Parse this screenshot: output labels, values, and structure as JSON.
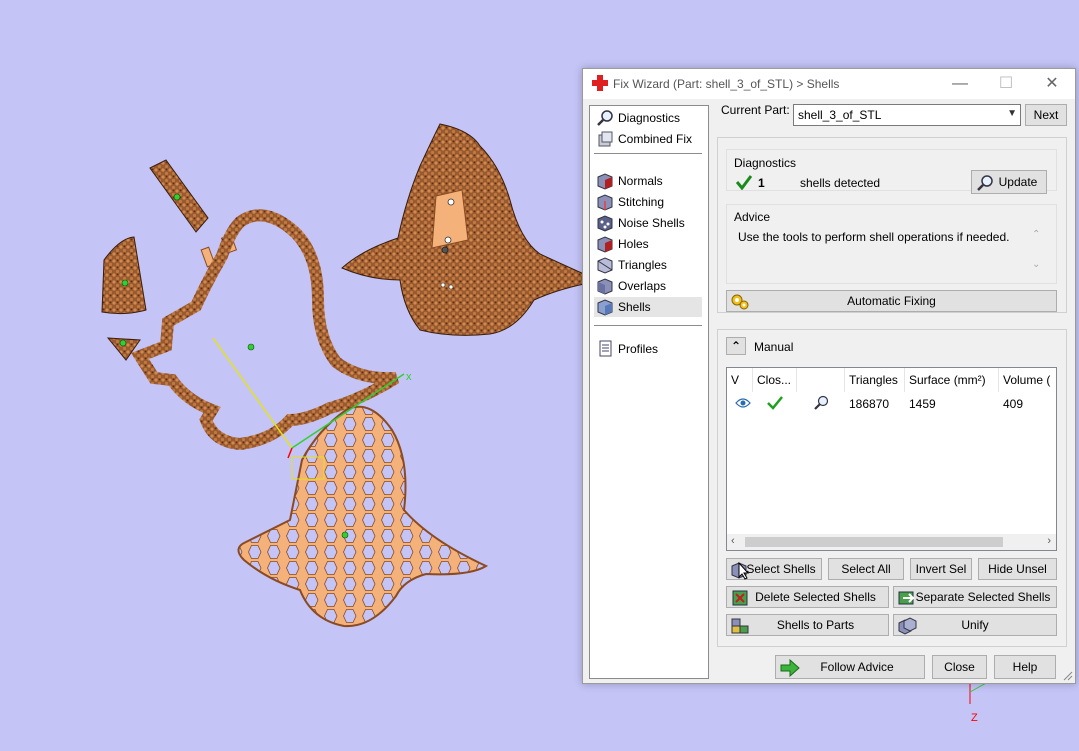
{
  "window": {
    "title": "Fix Wizard (Part: shell_3_of_STL) > Shells",
    "minimize_glyph": "—",
    "maximize_glyph": "☐",
    "close_glyph": "✕"
  },
  "nav": {
    "items": [
      {
        "label": "Diagnostics",
        "icon": "magnifier-icon"
      },
      {
        "label": "Combined Fix",
        "icon": "combined-fix-icon"
      },
      {
        "label": "Normals",
        "icon": "normals-cube-icon"
      },
      {
        "label": "Stitching",
        "icon": "stitching-cube-icon"
      },
      {
        "label": "Noise Shells",
        "icon": "noise-shells-cube-icon"
      },
      {
        "label": "Holes",
        "icon": "holes-cube-icon"
      },
      {
        "label": "Triangles",
        "icon": "triangles-cube-icon"
      },
      {
        "label": "Overlaps",
        "icon": "overlaps-cube-icon"
      },
      {
        "label": "Shells",
        "icon": "shells-cube-icon",
        "selected": true
      },
      {
        "label": "Profiles",
        "icon": "profiles-document-icon"
      }
    ]
  },
  "current_part": {
    "label": "Current Part:",
    "value": "shell_3_of_STL",
    "next_label": "Next"
  },
  "diagnostics": {
    "title": "Diagnostics",
    "count": "1",
    "text": "shells detected",
    "update_label": "Update"
  },
  "advice": {
    "title": "Advice",
    "text": "Use the tools to perform shell operations if needed."
  },
  "automatic_fixing": {
    "label": "Automatic Fixing"
  },
  "manual": {
    "title": "Manual",
    "collapse_glyph": "⌃",
    "table": {
      "columns": [
        "V",
        "Clos...",
        "",
        "Triangles",
        "Surface (mm²)",
        "Volume ("
      ],
      "rows": [
        {
          "triangles": "186870",
          "surface": "1459",
          "volume": "409"
        }
      ]
    },
    "buttons": {
      "select_shells": "Select Shells",
      "select_all": "Select All",
      "invert_sel": "Invert Sel",
      "hide_unsel": "Hide Unsel",
      "delete_selected": "Delete Selected Shells",
      "separate_selected": "Separate Selected Shells",
      "shells_to_parts": "Shells to Parts",
      "unify": "Unify"
    }
  },
  "footer": {
    "follow_advice": "Follow Advice",
    "close": "Close",
    "help": "Help"
  },
  "viewport": {
    "axis_x": "x",
    "axis_z": "Z"
  },
  "colors": {
    "background": "#c4c4f7",
    "part_fill": "#f4b27a",
    "part_mesh": "#8a4a22",
    "axis_x": "#2fd02f",
    "axis_y": "#e3e31a",
    "axis_z": "#ff0000"
  }
}
